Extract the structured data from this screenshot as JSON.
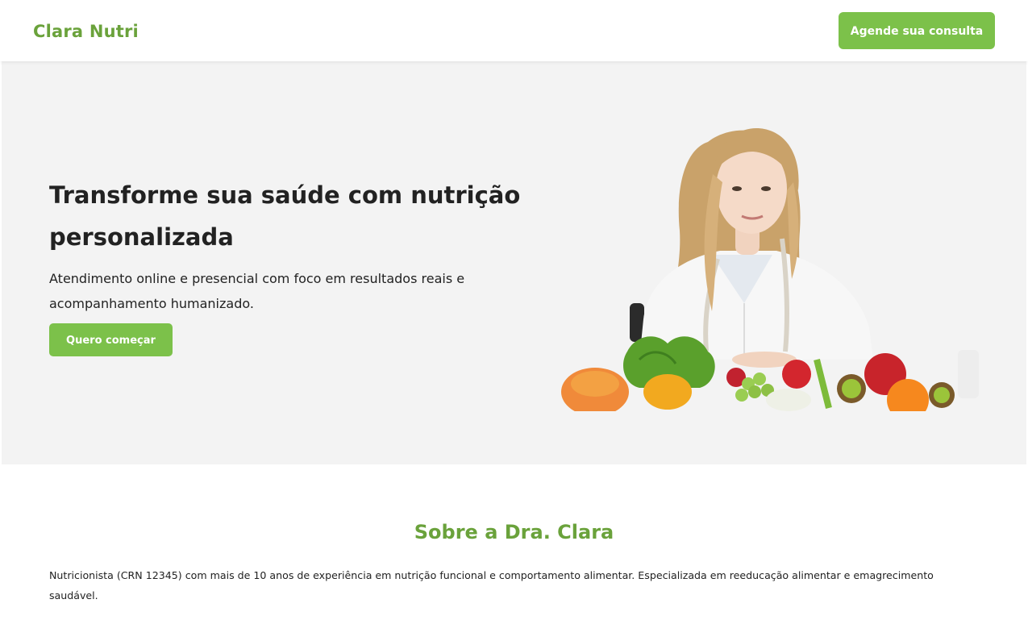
{
  "header": {
    "brand": "Clara Nutri",
    "cta_label": "Agende sua consulta"
  },
  "hero": {
    "title": "Transforme sua saúde com nutrição personalizada",
    "subtitle": "Atendimento online e presencial com foco em resultados reais e acompanhamento humanizado.",
    "cta_label": "Quero começar",
    "image_icon": "nutritionist-with-vegetables-photo"
  },
  "about": {
    "title": "Sobre a Dra. Clara",
    "text": "Nutricionista (CRN 12345) com mais de 10 anos de experiência em nutrição funcional e comportamento alimentar. Especializada em reeducação alimentar e emagrecimento saudável."
  },
  "colors": {
    "brand_green": "#6aa23b",
    "button_green": "#7cc14a",
    "hero_bg": "#f3f3f3",
    "text": "#222222"
  }
}
